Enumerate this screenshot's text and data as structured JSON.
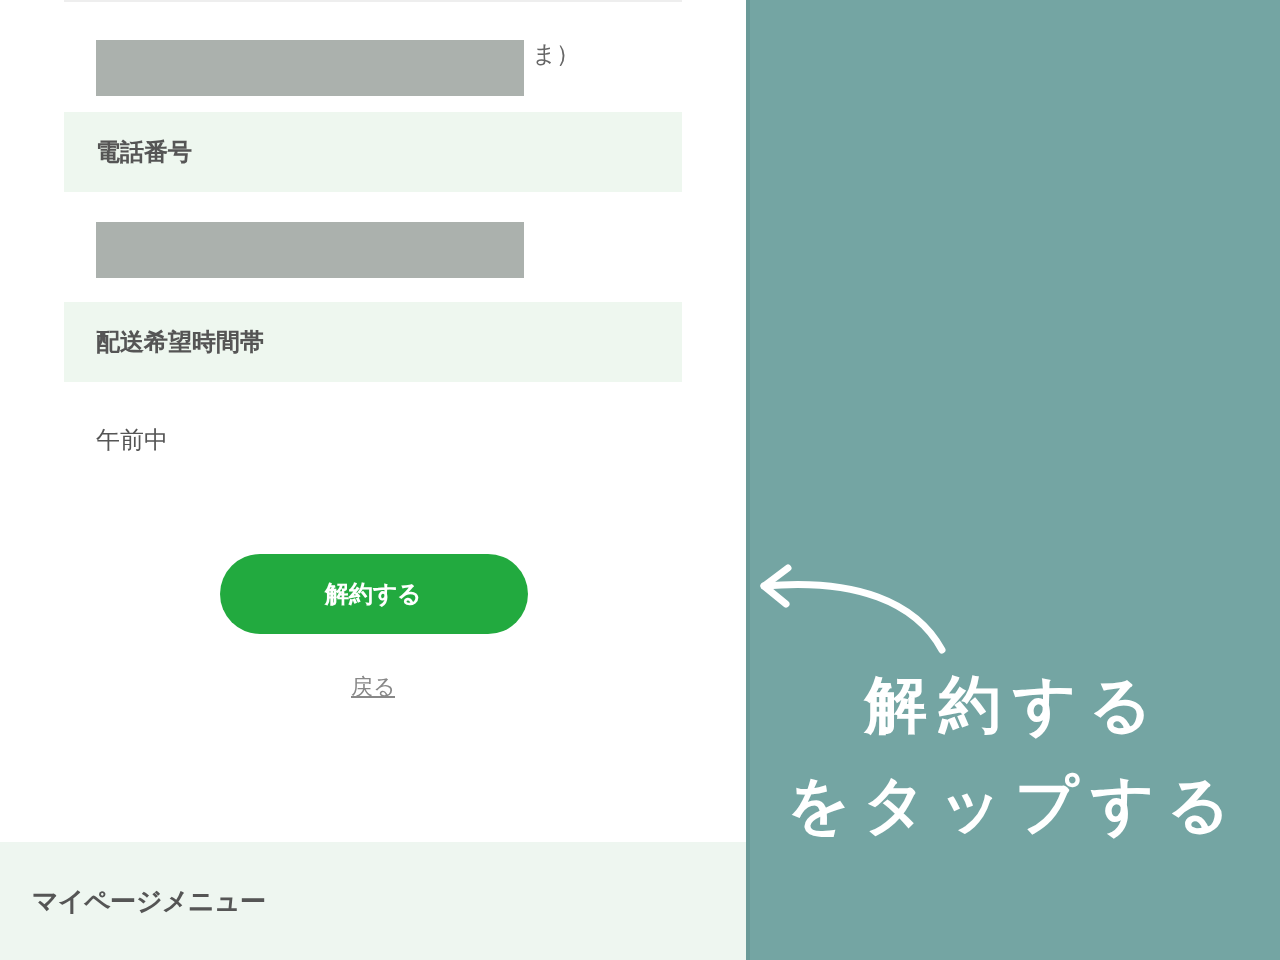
{
  "form": {
    "rows": [
      {
        "kind": "redacted",
        "trailing": "ま）"
      },
      {
        "kind": "label",
        "text": "電話番号"
      },
      {
        "kind": "redacted"
      },
      {
        "kind": "label",
        "text": "配送希望時間帯"
      },
      {
        "kind": "value",
        "text": "午前中"
      }
    ]
  },
  "primary_button": "解約する",
  "back_link": "戻る",
  "footer": {
    "title": "マイページメニュー"
  },
  "callout": {
    "lines": [
      "解約する",
      "をタップする"
    ]
  }
}
